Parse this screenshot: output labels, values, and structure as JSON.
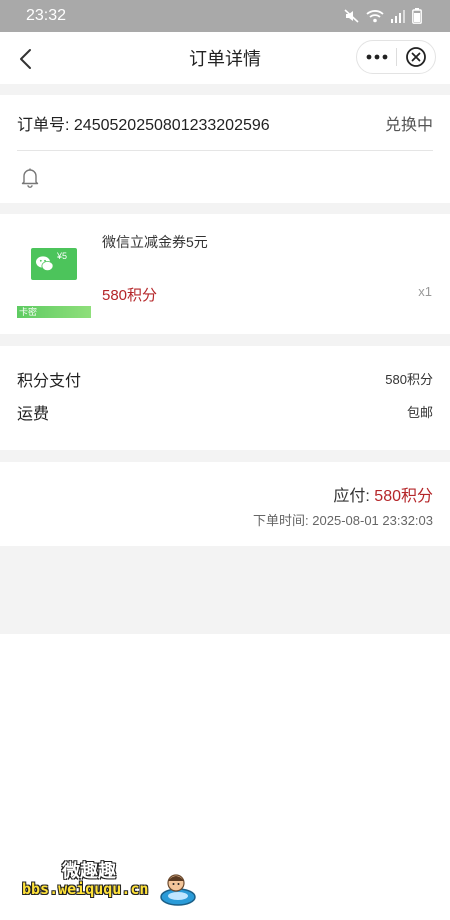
{
  "status_bar": {
    "time": "23:32"
  },
  "nav": {
    "title": "订单详情"
  },
  "order": {
    "number_label": "订单号:",
    "number": "2450520250801233202596",
    "status": "兑换中"
  },
  "product": {
    "name": "微信立减金券5元",
    "price": "580积分",
    "quantity": "x1",
    "tag": "卡密",
    "thumb_amount": "¥5"
  },
  "payment": {
    "points_label": "积分支付",
    "points_value": "580积分",
    "shipping_label": "运费",
    "shipping_value": "包邮"
  },
  "total": {
    "due_label": "应付:",
    "due_value": "580积分",
    "time_label": "下单时间:",
    "time_value": "2025-08-01 23:32:03"
  },
  "watermark": {
    "top": "微趣趣",
    "bottom": "bbs.weiququ.cn"
  },
  "colors": {
    "accent": "#b5272a",
    "background_gray": "#f3f3f3",
    "status_bar": "#a9a9a9"
  },
  "icons": [
    "back-arrow-icon",
    "more-dots-icon",
    "close-circle-icon",
    "bell-icon",
    "wechat-icon",
    "mute-icon",
    "wifi-icon",
    "signal-icon",
    "battery-icon"
  ]
}
